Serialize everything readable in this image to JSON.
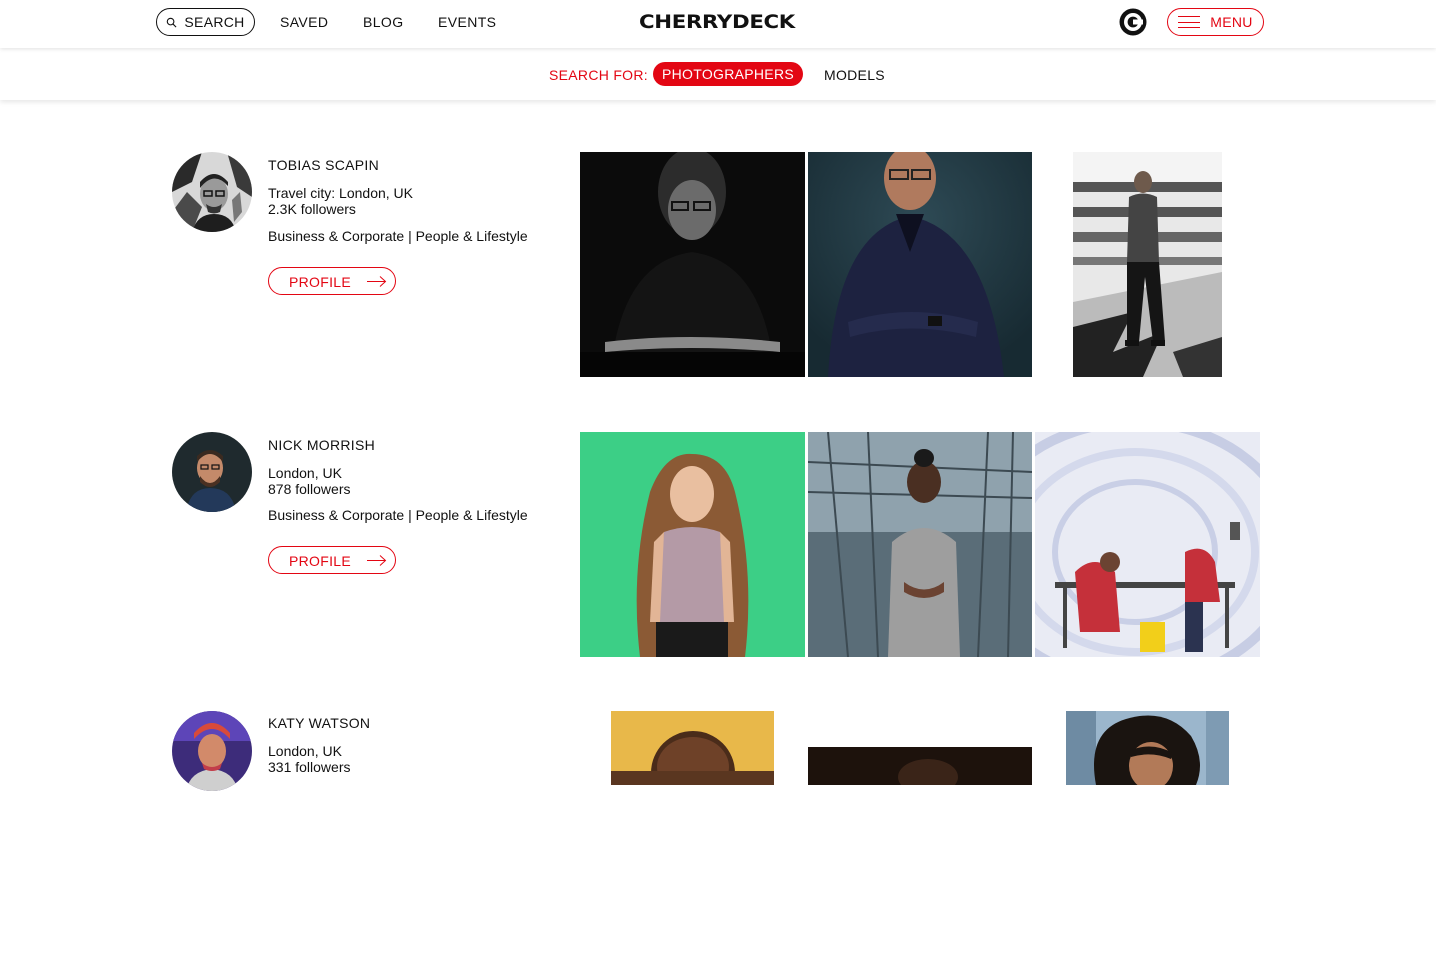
{
  "header": {
    "search_label": "SEARCH",
    "nav": [
      "SAVED",
      "BLOG",
      "EVENTS"
    ],
    "logo": "CHERRYDECK",
    "menu_label": "MENU"
  },
  "filter": {
    "label": "SEARCH FOR:",
    "options": [
      "PHOTOGRAPHERS",
      "MODELS"
    ],
    "selected": "PHOTOGRAPHERS"
  },
  "photographers": [
    {
      "name": "TOBIAS SCAPIN",
      "city": "Travel city: London, UK",
      "followers": "2.3K followers",
      "categories": "Business & Corporate | People & Lifestyle",
      "profile_label": "PROFILE"
    },
    {
      "name": "NICK MORRISH",
      "city": "London, UK",
      "followers": "878 followers",
      "categories": "Business & Corporate | People & Lifestyle",
      "profile_label": "PROFILE"
    },
    {
      "name": "KATY WATSON",
      "city": "London, UK",
      "followers": "331 followers"
    }
  ],
  "colors": {
    "accent": "#e30613",
    "text": "#111111",
    "background": "#ffffff"
  }
}
